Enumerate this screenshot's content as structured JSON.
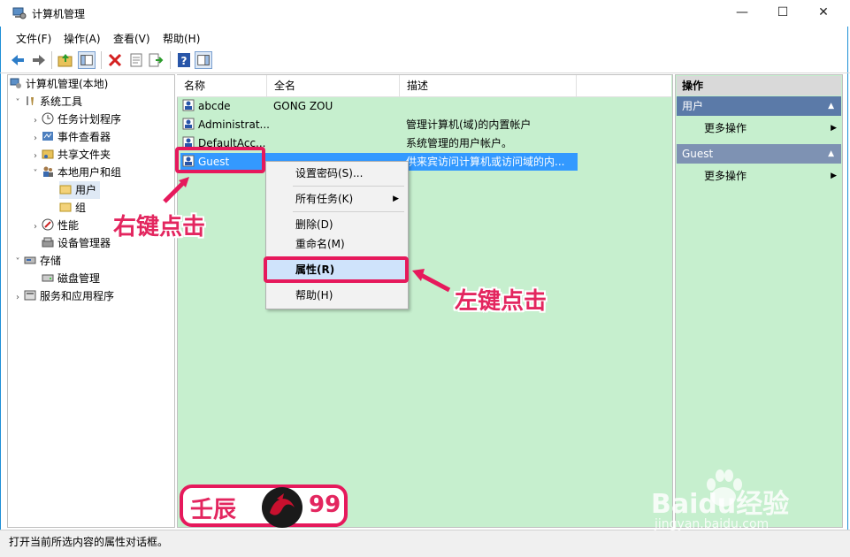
{
  "window": {
    "title": "计算机管理",
    "minimize": "—",
    "maximize": "☐",
    "close": "✕"
  },
  "menu": [
    "文件(F)",
    "操作(A)",
    "查看(V)",
    "帮助(H)"
  ],
  "tree": {
    "root": "计算机管理(本地)",
    "system_tools": "系统工具",
    "task_scheduler": "任务计划程序",
    "event_viewer": "事件查看器",
    "shared_folders": "共享文件夹",
    "local_users": "本地用户和组",
    "users": "用户",
    "groups": "组",
    "performance": "性能",
    "device_manager": "设备管理器",
    "storage": "存储",
    "disk_mgmt": "磁盘管理",
    "services_apps": "服务和应用程序"
  },
  "list": {
    "columns": [
      "名称",
      "全名",
      "描述"
    ],
    "rows": [
      {
        "name": "abcde",
        "fullname": "GONG ZOU",
        "desc": ""
      },
      {
        "name": "Administrat...",
        "fullname": "",
        "desc": "管理计算机(域)的内置帐户"
      },
      {
        "name": "DefaultAcc...",
        "fullname": "",
        "desc": "系统管理的用户帐户。"
      },
      {
        "name": "Guest",
        "fullname": "",
        "desc": "供来宾访问计算机或访问域的内..."
      }
    ]
  },
  "context_menu": {
    "set_password": "设置密码(S)...",
    "all_tasks": "所有任务(K)",
    "delete": "删除(D)",
    "rename": "重命名(M)",
    "properties": "属性(R)",
    "help": "帮助(H)"
  },
  "actions": {
    "title": "操作",
    "section1": "用户",
    "more1": "更多操作",
    "section2": "Guest",
    "more2": "更多操作"
  },
  "status": "打开当前所选内容的属性对话框。",
  "annotations": {
    "right_click": "右键点击",
    "left_click": "左键点击",
    "brand_left": "壬辰",
    "brand_right": "99",
    "watermark_main": "Baidu经验",
    "watermark_sub": "jingyan.baidu.com"
  },
  "colors": {
    "accent": "#1e8fd6",
    "selection": "#3399ff",
    "pane_bg": "#c6efce",
    "annotation": "#e6195c"
  }
}
